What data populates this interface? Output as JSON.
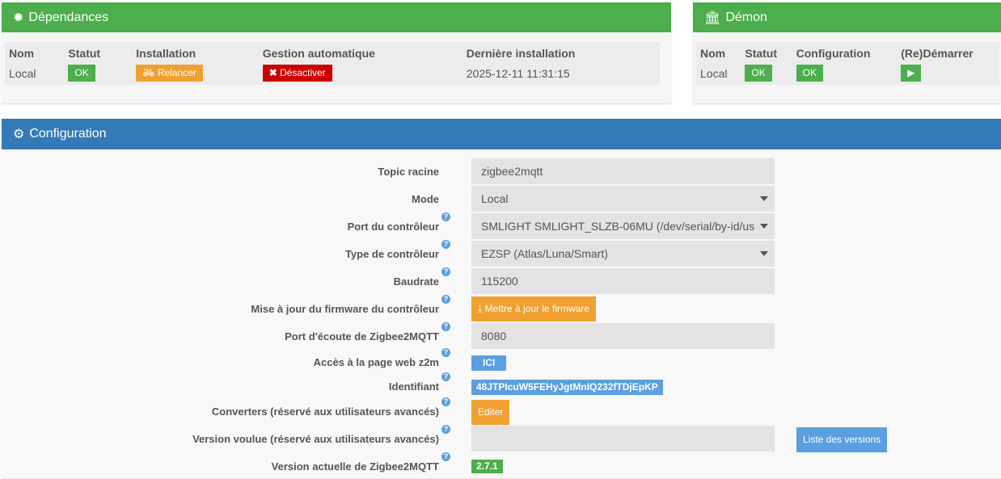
{
  "deps": {
    "title": "Dépendances",
    "headers": [
      "Nom",
      "Statut",
      "Installation",
      "Gestion automatique",
      "Dernière installation"
    ],
    "name": "Local",
    "status": "OK",
    "install": "Relancer",
    "auto": "Désactiver",
    "last": "2025-12-11 11:31:15"
  },
  "daemon": {
    "title": "Démon",
    "headers": [
      "Nom",
      "Statut",
      "Configuration",
      "(Re)Démarrer"
    ],
    "name": "Local",
    "status": "OK",
    "config": "OK"
  },
  "config": {
    "title": "Configuration",
    "topic_label": "Topic racine",
    "topic": "zigbee2mqtt",
    "mode_label": "Mode",
    "mode": "Local",
    "port_label": "Port du contrôleur",
    "port": "SMLIGHT SMLIGHT_SLZB-06MU (/dev/serial/by-id/us",
    "type_label": "Type de contrôleur",
    "type": "EZSP (Atlas/Luna/Smart)",
    "baud_label": "Baudrate",
    "baud": "115200",
    "fw_label": "Mise à jour du firmware du contrôleur",
    "fw_btn": "Mettre à jour le firmware",
    "listen_label": "Port d'écoute de Zigbee2MQTT",
    "listen": "8080",
    "web_label": "Accès à la page web z2m",
    "web_btn": "ICI",
    "id_label": "Identifiant",
    "id": "48JTPIcuW5FEHyJgtMnIQ232fTDjEpKP",
    "conv_label": "Converters (réservé aux utilisateurs avancés)",
    "conv_btn": "Editer",
    "ver_label": "Version voulue (réservé aux utilisateurs avancés)",
    "ver": "",
    "ver_btn": "Liste des versions",
    "cur_label": "Version actuelle de Zigbee2MQTT",
    "cur": "2.7.1"
  }
}
